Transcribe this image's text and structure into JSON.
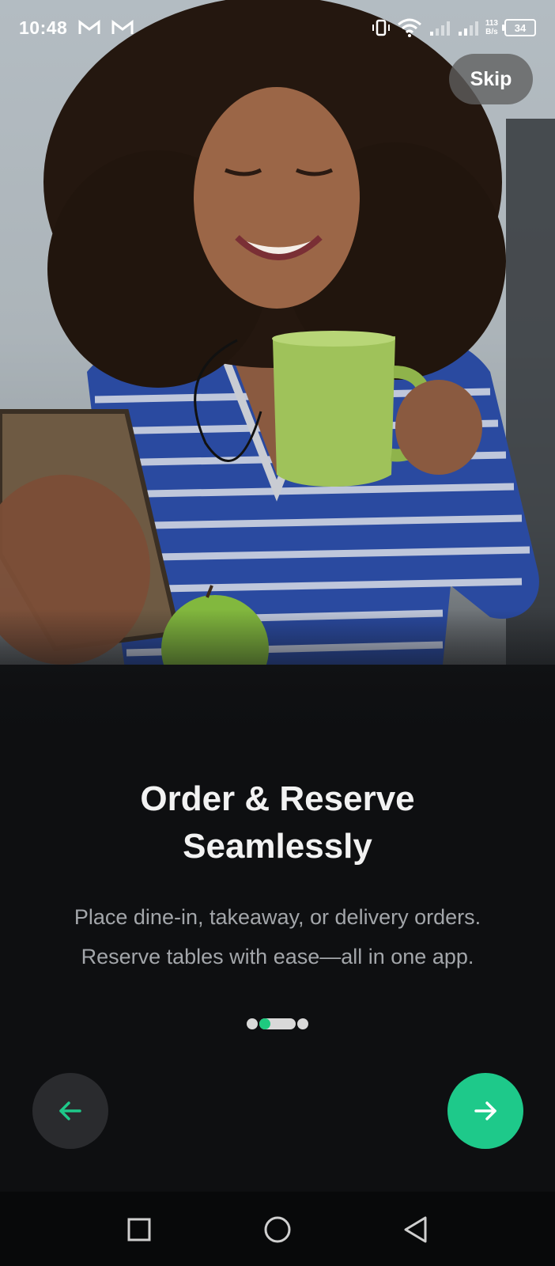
{
  "status_bar": {
    "time": "10:48",
    "network_speed_value": "113",
    "network_speed_unit": "B/s",
    "battery": "34",
    "icons": [
      "gmail-icon",
      "gmail-icon",
      "vibrate-icon",
      "wifi-icon",
      "signal-icon",
      "signal-icon",
      "battery-icon"
    ]
  },
  "skip_label": "Skip",
  "onboarding": {
    "title_line1": "Order & Reserve",
    "title_line2": "Seamlessly",
    "subtitle_line1": "Place dine-in, takeaway, or delivery orders.",
    "subtitle_line2": "Reserve tables with ease—all in one app.",
    "pager": {
      "total": 3,
      "active_index": 1
    }
  },
  "navigation": {
    "back_icon": "arrow-left-icon",
    "next_icon": "arrow-right-icon"
  },
  "system_nav": [
    "square-recents-icon",
    "circle-home-icon",
    "triangle-back-icon"
  ],
  "colors": {
    "accent": "#1ec98a",
    "background": "#0e0f11",
    "back_button": "#2a2b2e",
    "subtitle": "#a3a6aa"
  }
}
